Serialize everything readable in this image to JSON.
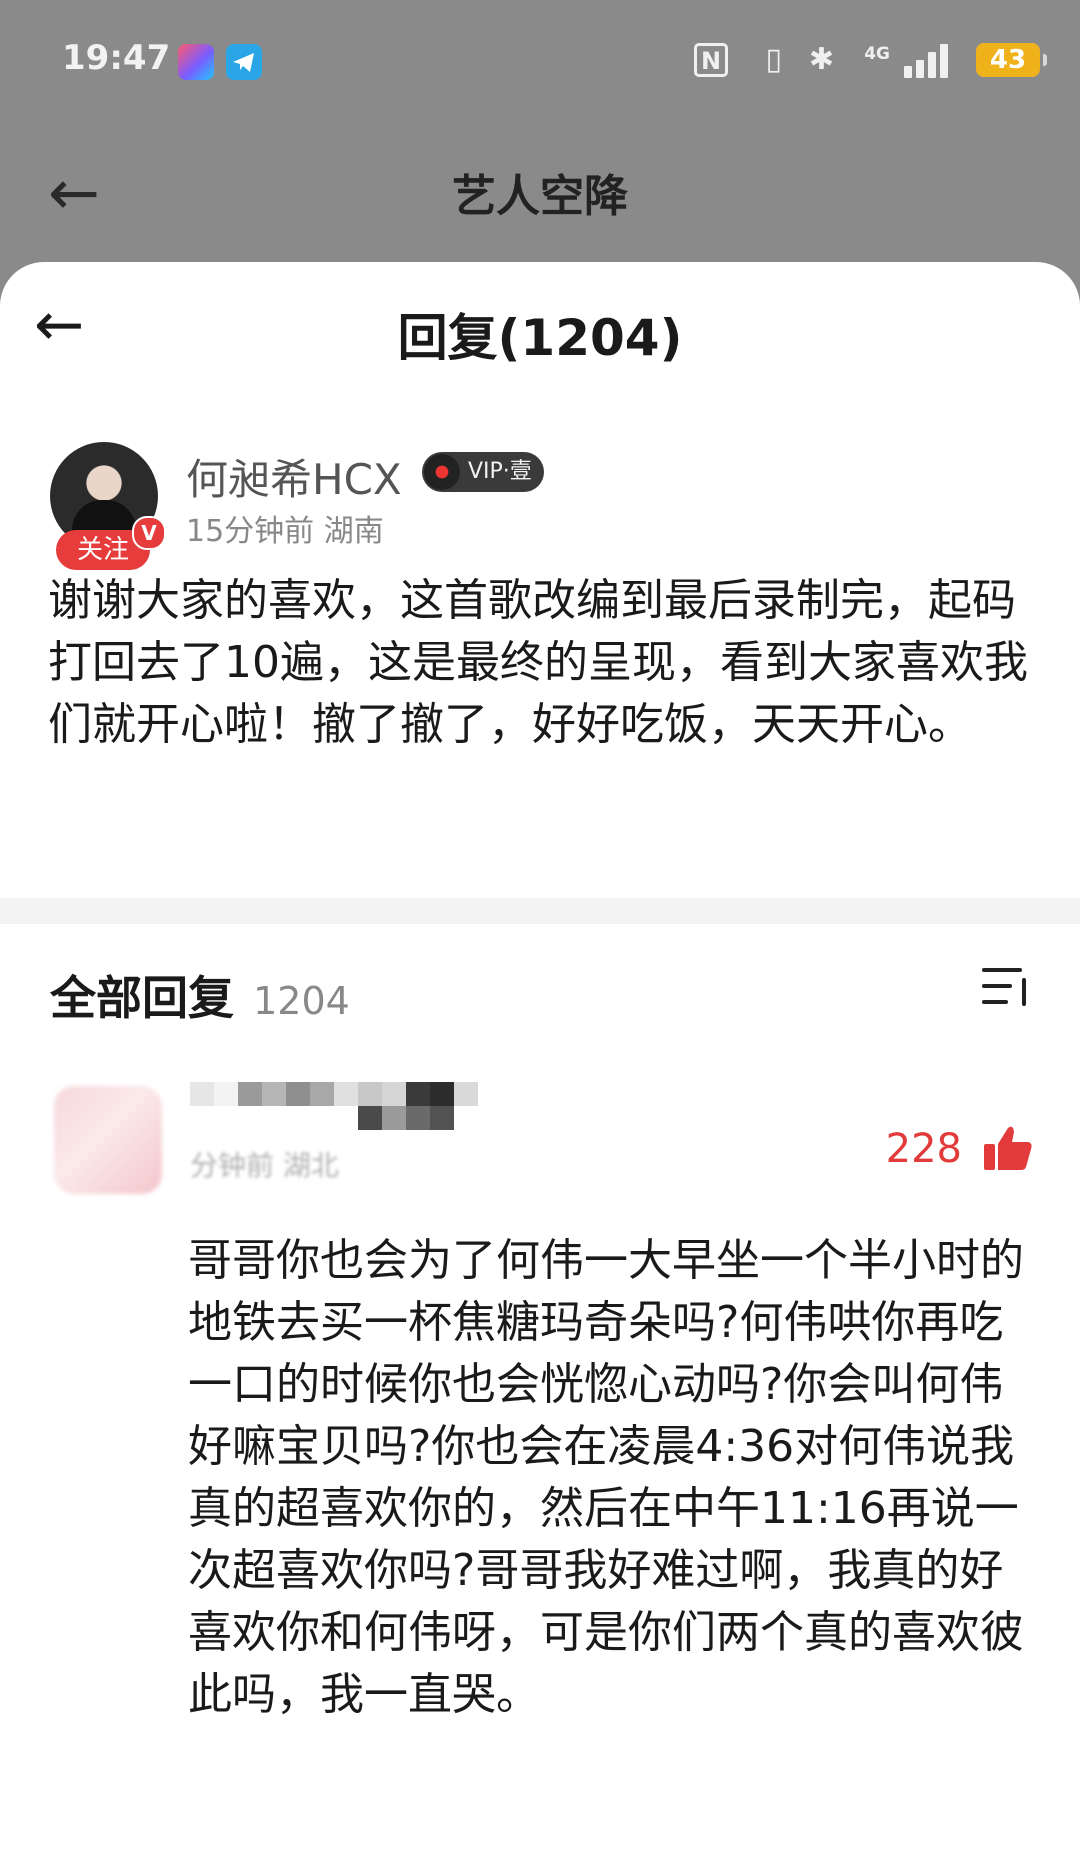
{
  "status_bar": {
    "time": "19:47",
    "network": "4G",
    "battery": "43"
  },
  "header": {
    "back_icon": "arrow-left-icon",
    "title": "艺人空降"
  },
  "sheet": {
    "back_icon": "arrow-left-icon",
    "title": "回复(1204)"
  },
  "post": {
    "author": "何昶希HCX",
    "vip_label": "VIP·壹",
    "follow_label": "关注",
    "verified_label": "V",
    "meta": "15分钟前 湖南",
    "text": "谢谢大家的喜欢，这首歌改编到最后录制完，起码打回去了10遍，这是最终的呈现，看到大家喜欢我们就开心啦！撤了撤了，好好吃饭，天天开心。"
  },
  "replies": {
    "title": "全部回复",
    "count": "1204",
    "sort_icon": "sort-icon"
  },
  "reply": {
    "meta_blurred": "分钟前 湖北",
    "likes": "228",
    "like_icon": "thumbs-up-icon",
    "text": "哥哥你也会为了何伟一大早坐一个半小时的地铁去买一杯焦糖玛奇朵吗?何伟哄你再吃一口的时候你也会恍惚心动吗?你会叫何伟好嘛宝贝吗?你也会在凌晨4:36对何伟说我真的超喜欢你的，然后在中午11:16再说一次超喜欢你吗?哥哥我好难过啊，我真的好喜欢你和何伟呀，可是你们两个真的喜欢彼此吗，我一直哭。"
  },
  "colors": {
    "accent_red": "#e33b3b",
    "dim_background": "#8a8a8a",
    "battery": "#f0b21b"
  }
}
